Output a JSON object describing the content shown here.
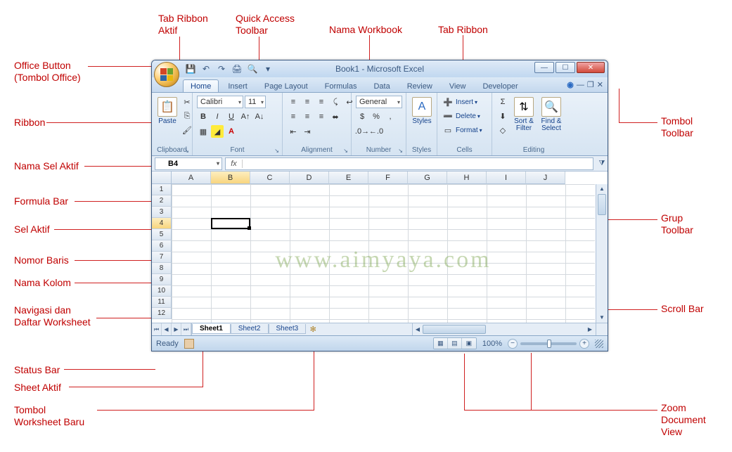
{
  "annotations": {
    "office_button": "Office Button\n(Tombol Office)",
    "tab_ribbon_aktif": "Tab Ribbon\nAktif",
    "quick_access": "Quick Access\nToolbar",
    "nama_workbook": "Nama Workbook",
    "tab_ribbon": "Tab Ribbon",
    "ribbon": "Ribbon",
    "nama_sel_aktif": "Nama Sel Aktif",
    "formula_bar": "Formula Bar",
    "sel_aktif": "Sel Aktif",
    "nomor_baris": "Nomor Baris",
    "nama_kolom": "Nama Kolom",
    "navigasi": "Navigasi dan\nDaftar Worksheet",
    "status_bar": "Status Bar",
    "sheet_aktif": "Sheet Aktif",
    "tombol_worksheet": "Tombol\nWorksheet Baru",
    "tombol_toolbar": "Tombol\nToolbar",
    "grup_toolbar": "Grup\nToolbar",
    "scroll_bar": "Scroll Bar",
    "zoom_view": "Zoom\nDocument\nView"
  },
  "title": "Book1 - Microsoft Excel",
  "tabs": [
    "Home",
    "Insert",
    "Page Layout",
    "Formulas",
    "Data",
    "Review",
    "View",
    "Developer"
  ],
  "active_tab_index": 0,
  "ribbon": {
    "clipboard": {
      "label": "Clipboard",
      "paste": "Paste"
    },
    "font": {
      "label": "Font",
      "name": "Calibri",
      "size": "11"
    },
    "alignment": {
      "label": "Alignment"
    },
    "number": {
      "label": "Number",
      "format": "General"
    },
    "styles": {
      "label": "Styles",
      "btn": "Styles"
    },
    "cells": {
      "label": "Cells",
      "insert": "Insert",
      "delete": "Delete",
      "format": "Format"
    },
    "editing": {
      "label": "Editing",
      "sort": "Sort &\nFilter",
      "find": "Find &\nSelect"
    }
  },
  "namebox": "B4",
  "fx_label": "fx",
  "columns": [
    "A",
    "B",
    "C",
    "D",
    "E",
    "F",
    "G",
    "H",
    "I",
    "J"
  ],
  "active_col_index": 1,
  "rows": [
    1,
    2,
    3,
    4,
    5,
    6,
    7,
    8,
    9,
    10,
    11,
    12
  ],
  "active_row_index": 3,
  "watermark": "www.aimyaya.com",
  "sheets": [
    "Sheet1",
    "Sheet2",
    "Sheet3"
  ],
  "active_sheet_index": 0,
  "status": {
    "ready": "Ready",
    "zoom": "100%"
  }
}
